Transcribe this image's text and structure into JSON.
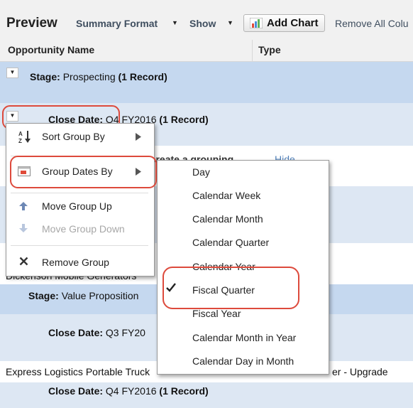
{
  "toolbar": {
    "title": "Preview",
    "summary_format": "Summary Format",
    "show": "Show",
    "add_chart": "Add Chart",
    "remove_all": "Remove All Colu"
  },
  "columns": [
    "Opportunity Name",
    "Type"
  ],
  "rows": [
    {
      "label": "Stage:",
      "value": "Prospecting",
      "count": "(1 Record)"
    },
    {
      "label": "Close Date:",
      "value": "Q4 FY2016",
      "count": "(1 Record)"
    },
    {
      "hint": "e create a grouping.",
      "hide": "Hide"
    },
    {
      "text": "Dickenson Mobile Generators"
    },
    {
      "label": "Stage:",
      "value": "Value Proposition"
    },
    {
      "label": "Close Date:",
      "value": "Q3 FY20"
    },
    {
      "text": "Express Logistics Portable Truck",
      "type": "er - Upgrade"
    },
    {
      "label": "Close Date:",
      "value": "Q4 FY2016",
      "count": "(1 Record)"
    }
  ],
  "group_menu": {
    "items": [
      {
        "label": "Sort Group By",
        "icon": "sort-az-icon",
        "submenu": true,
        "enabled": true
      },
      {
        "label": "Group Dates By",
        "icon": "calendar-icon",
        "submenu": true,
        "enabled": true
      },
      {
        "label": "Move Group Up",
        "icon": "arrow-up-icon",
        "enabled": true
      },
      {
        "label": "Move Group Down",
        "icon": "arrow-down-icon",
        "enabled": false
      },
      {
        "label": "Remove Group",
        "icon": "close-icon",
        "enabled": true
      }
    ]
  },
  "date_menu": {
    "items": [
      "Day",
      "Calendar Week",
      "Calendar Month",
      "Calendar Quarter",
      "Calendar Year",
      "Fiscal Quarter",
      "Fiscal Year",
      "Calendar Month in Year",
      "Calendar Day in Month"
    ],
    "selected": "Fiscal Quarter"
  },
  "colors": {
    "highlight": "#dd4a3c",
    "group_row": "#c5d8ef",
    "toolbar": "#f1f1f1"
  }
}
